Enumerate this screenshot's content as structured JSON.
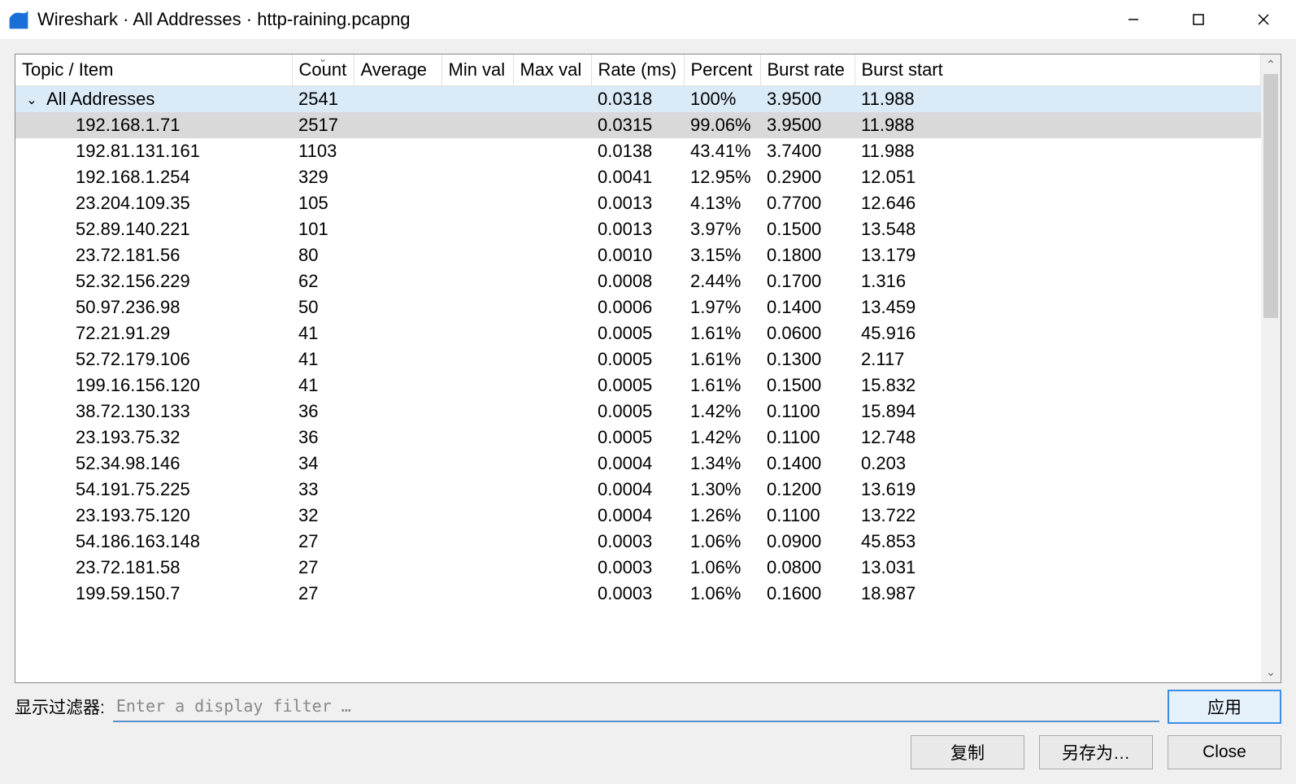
{
  "window": {
    "title": "Wireshark · All Addresses · http-raining.pcapng"
  },
  "columns": {
    "topic": "Topic / Item",
    "count": "Count",
    "average": "Average",
    "minval": "Min val",
    "maxval": "Max val",
    "rate": "Rate (ms)",
    "percent": "Percent",
    "burstrate": "Burst rate",
    "burststart": "Burst start"
  },
  "parent": {
    "topic": "All Addresses",
    "count": "2541",
    "rate": "0.0318",
    "percent": "100%",
    "burstrate": "3.9500",
    "burststart": "11.988"
  },
  "rows": [
    {
      "topic": "192.168.1.71",
      "count": "2517",
      "rate": "0.0315",
      "percent": "99.06%",
      "burstrate": "3.9500",
      "burststart": "11.988"
    },
    {
      "topic": "192.81.131.161",
      "count": "1103",
      "rate": "0.0138",
      "percent": "43.41%",
      "burstrate": "3.7400",
      "burststart": "11.988"
    },
    {
      "topic": "192.168.1.254",
      "count": "329",
      "rate": "0.0041",
      "percent": "12.95%",
      "burstrate": "0.2900",
      "burststart": "12.051"
    },
    {
      "topic": "23.204.109.35",
      "count": "105",
      "rate": "0.0013",
      "percent": "4.13%",
      "burstrate": "0.7700",
      "burststart": "12.646"
    },
    {
      "topic": "52.89.140.221",
      "count": "101",
      "rate": "0.0013",
      "percent": "3.97%",
      "burstrate": "0.1500",
      "burststart": "13.548"
    },
    {
      "topic": "23.72.181.56",
      "count": "80",
      "rate": "0.0010",
      "percent": "3.15%",
      "burstrate": "0.1800",
      "burststart": "13.179"
    },
    {
      "topic": "52.32.156.229",
      "count": "62",
      "rate": "0.0008",
      "percent": "2.44%",
      "burstrate": "0.1700",
      "burststart": "1.316"
    },
    {
      "topic": "50.97.236.98",
      "count": "50",
      "rate": "0.0006",
      "percent": "1.97%",
      "burstrate": "0.1400",
      "burststart": "13.459"
    },
    {
      "topic": "72.21.91.29",
      "count": "41",
      "rate": "0.0005",
      "percent": "1.61%",
      "burstrate": "0.0600",
      "burststart": "45.916"
    },
    {
      "topic": "52.72.179.106",
      "count": "41",
      "rate": "0.0005",
      "percent": "1.61%",
      "burstrate": "0.1300",
      "burststart": "2.117"
    },
    {
      "topic": "199.16.156.120",
      "count": "41",
      "rate": "0.0005",
      "percent": "1.61%",
      "burstrate": "0.1500",
      "burststart": "15.832"
    },
    {
      "topic": "38.72.130.133",
      "count": "36",
      "rate": "0.0005",
      "percent": "1.42%",
      "burstrate": "0.1100",
      "burststart": "15.894"
    },
    {
      "topic": "23.193.75.32",
      "count": "36",
      "rate": "0.0005",
      "percent": "1.42%",
      "burstrate": "0.1100",
      "burststart": "12.748"
    },
    {
      "topic": "52.34.98.146",
      "count": "34",
      "rate": "0.0004",
      "percent": "1.34%",
      "burstrate": "0.1400",
      "burststart": "0.203"
    },
    {
      "topic": "54.191.75.225",
      "count": "33",
      "rate": "0.0004",
      "percent": "1.30%",
      "burstrate": "0.1200",
      "burststart": "13.619"
    },
    {
      "topic": "23.193.75.120",
      "count": "32",
      "rate": "0.0004",
      "percent": "1.26%",
      "burstrate": "0.1100",
      "burststart": "13.722"
    },
    {
      "topic": "54.186.163.148",
      "count": "27",
      "rate": "0.0003",
      "percent": "1.06%",
      "burstrate": "0.0900",
      "burststart": "45.853"
    },
    {
      "topic": "23.72.181.58",
      "count": "27",
      "rate": "0.0003",
      "percent": "1.06%",
      "burstrate": "0.0800",
      "burststart": "13.031"
    },
    {
      "topic": "199.59.150.7",
      "count": "27",
      "rate": "0.0003",
      "percent": "1.06%",
      "burstrate": "0.1600",
      "burststart": "18.987"
    }
  ],
  "filter": {
    "label": "显示过滤器:",
    "placeholder": "Enter a display filter …"
  },
  "buttons": {
    "apply": "应用",
    "copy": "复制",
    "saveas": "另存为…",
    "close": "Close"
  }
}
